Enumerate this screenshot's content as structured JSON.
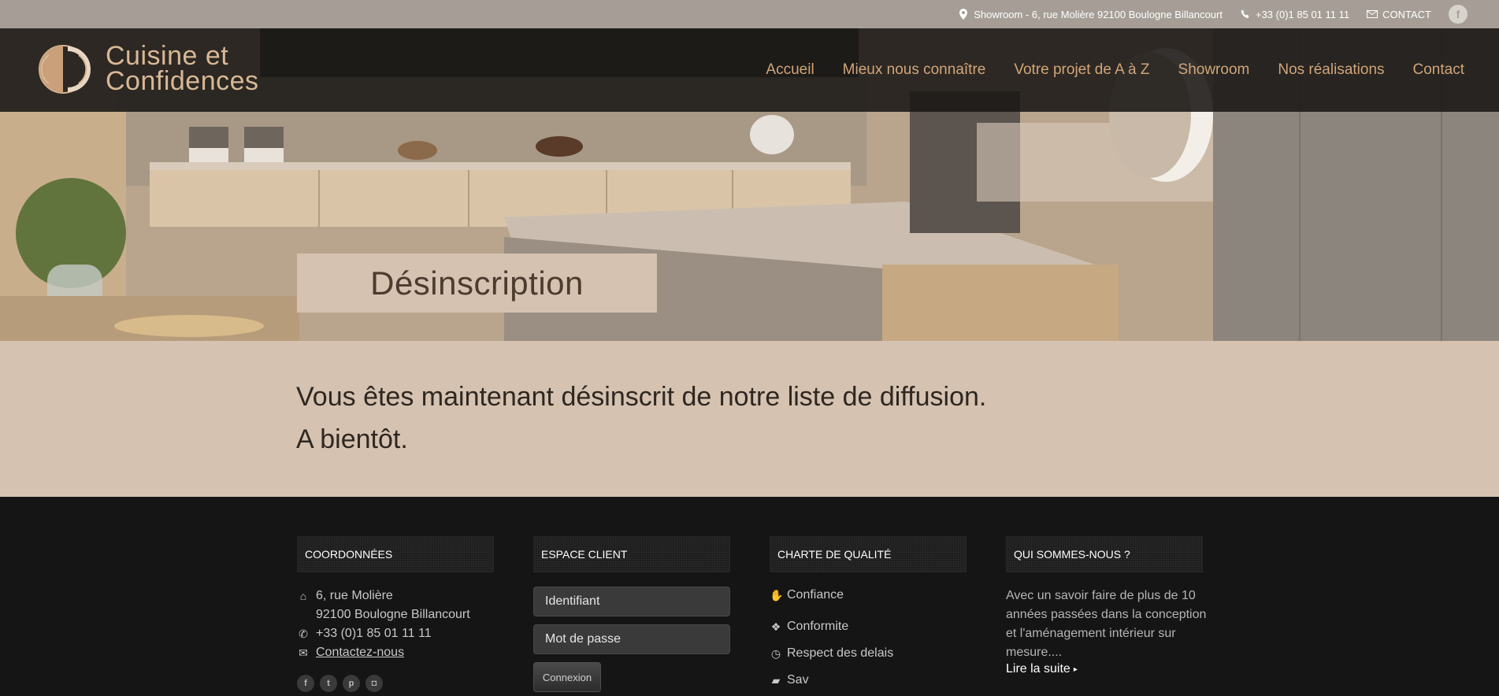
{
  "topbar": {
    "showroom": "Showroom - 6, rue Molière 92100 Boulogne Billancourt",
    "phone": "+33 (0)1 85 01 11 11",
    "contact": "CONTACT",
    "facebook_glyph": "f"
  },
  "brand": {
    "logo_line1": "Cuisine et",
    "logo_line2": "Confidences",
    "accent_color": "#d1a57a"
  },
  "nav": {
    "items": [
      "Accueil",
      "Mieux nous connaître",
      "Votre projet de A à Z",
      "Showroom",
      "Nos réalisations",
      "Contact"
    ]
  },
  "page": {
    "title": "Désinscription"
  },
  "message": {
    "line1": "Vous êtes maintenant désinscrit de notre liste de diffusion.",
    "line2": "A bientôt."
  },
  "footer": {
    "coordonnees": {
      "heading": "COORDONNÉES",
      "address1": "6, rue Molière",
      "address2": "92100 Boulogne Billancourt",
      "phone": "+33 (0)1 85 01 11 11",
      "contact_link": "Contactez-nous",
      "social_icons": [
        "facebook-icon",
        "twitter-icon",
        "pinterest-icon",
        "instagram-icon"
      ]
    },
    "espace_client": {
      "heading": "ESPACE CLIENT",
      "identifiant_placeholder": "Identifiant",
      "password_placeholder": "Mot de passe",
      "login_label": "Connexion"
    },
    "charte": {
      "heading": "CHARTE DE QUALITÉ",
      "items": [
        "Confiance",
        "Conformite",
        "Respect des delais",
        "Sav"
      ]
    },
    "about": {
      "heading": "QUI SOMMES-NOUS ?",
      "text": "Avec un savoir faire de plus de 10 années passées dans la conception et l'aménagement intérieur sur mesure....",
      "read_more": "Lire la suite"
    }
  }
}
